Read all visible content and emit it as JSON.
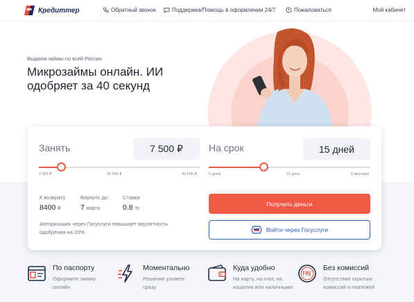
{
  "header": {
    "logo_text": "Кредиттер",
    "nav": [
      {
        "label": "Обратный звонок",
        "icon": "phone-icon"
      },
      {
        "label": "Поддержка/Помощь в оформлении 24/7",
        "icon": "chat-icon"
      },
      {
        "label": "Пожаловаться",
        "icon": "flag-icon"
      }
    ],
    "cabinet_label": "Мой кабинет"
  },
  "hero": {
    "subtitle": "Выдаем займы по всей России",
    "title": "Микрозаймы онлайн. ИИ одобряет за 40 секунд"
  },
  "calculator": {
    "amount": {
      "label": "Занять",
      "value": "7 500 ₽",
      "ticks": [
        "2 000 ₽",
        "20 000 ₽",
        "40 000 ₽"
      ],
      "slider_fraction": 0.14
    },
    "term": {
      "label": "На срок",
      "value": "15 дней",
      "ticks": [
        "5 дней",
        "21 день",
        "6 месяцев"
      ],
      "slider_fraction": 0.34
    },
    "stats": [
      {
        "label": "К возврату",
        "value": "8400",
        "unit": "₽"
      },
      {
        "label": "Вернуть до",
        "value": "7",
        "unit": "марта"
      },
      {
        "label": "Ставка",
        "value": "0.8",
        "unit": "%"
      }
    ],
    "note": "Авторизация через Госуслуги повышает вероятность одобрения на 20%",
    "primary_button": "Получить деньги",
    "secondary_button": "Войти через Госуслуги"
  },
  "features": [
    {
      "title": "По паспорту",
      "desc": "Оформите заявку онлайн",
      "icon": "passport-icon"
    },
    {
      "title": "Моментально",
      "desc": "Решение узнаете сразу",
      "icon": "lightning-icon"
    },
    {
      "title": "Куда удобно",
      "desc": "На карту, на счет, на кошелек или наличными",
      "icon": "wallet-icon"
    },
    {
      "title": "Без комиссий",
      "desc": "Отсутствие скрытых комиссий и платежей",
      "icon": "free-badge-icon"
    }
  ],
  "colors": {
    "accent": "#f05a45",
    "secondary": "#2f5db7"
  }
}
